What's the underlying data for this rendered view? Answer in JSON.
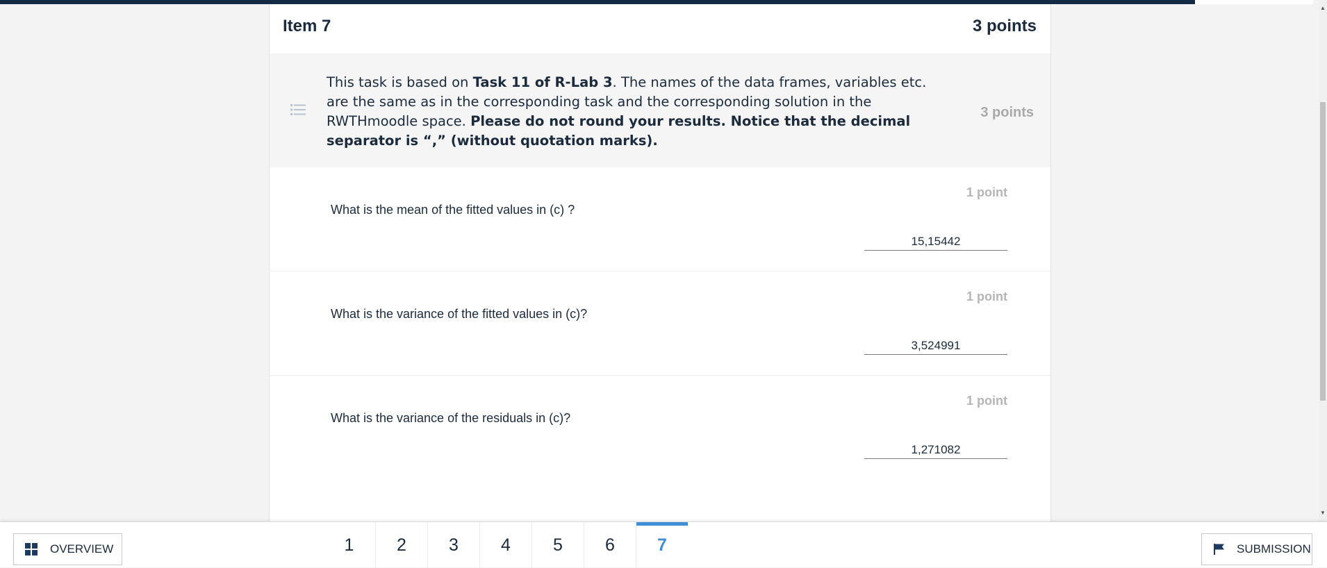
{
  "item": {
    "title": "Item 7",
    "points": "3 points"
  },
  "task": {
    "intro_before": "This task is based on ",
    "intro_bold": "Task 11 of R-Lab 3",
    "intro_after": ". The names of the data frames, variables etc. are the same as in the corresponding task and the corresponding solution in the RWTHmoodle space. ",
    "note_bold": "Please do not round your results. Notice that the decimal separator is “,” (without quotation marks).",
    "points": "3 points"
  },
  "questions": [
    {
      "points": "1 point",
      "text": "What is the mean of the fitted values in (c) ?",
      "answer": "15,15442"
    },
    {
      "points": "1 point",
      "text": "What is the variance of the fitted values in (c)?",
      "answer": "3,524991"
    },
    {
      "points": "1 point",
      "text": "What is the variance of the residuals in (c)?",
      "answer": "1,271082"
    }
  ],
  "bottombar": {
    "overview_label": "OVERVIEW",
    "submission_label": "SUBMISSION",
    "pages": [
      "1",
      "2",
      "3",
      "4",
      "5",
      "6",
      "7"
    ],
    "active_page": "7"
  },
  "colors": {
    "accent": "#3f8fd8",
    "navy": "#132a45",
    "muted": "#a9a9a9"
  },
  "icons": {
    "task": "list-icon",
    "overview": "grid-icon",
    "submission": "flag-icon"
  }
}
